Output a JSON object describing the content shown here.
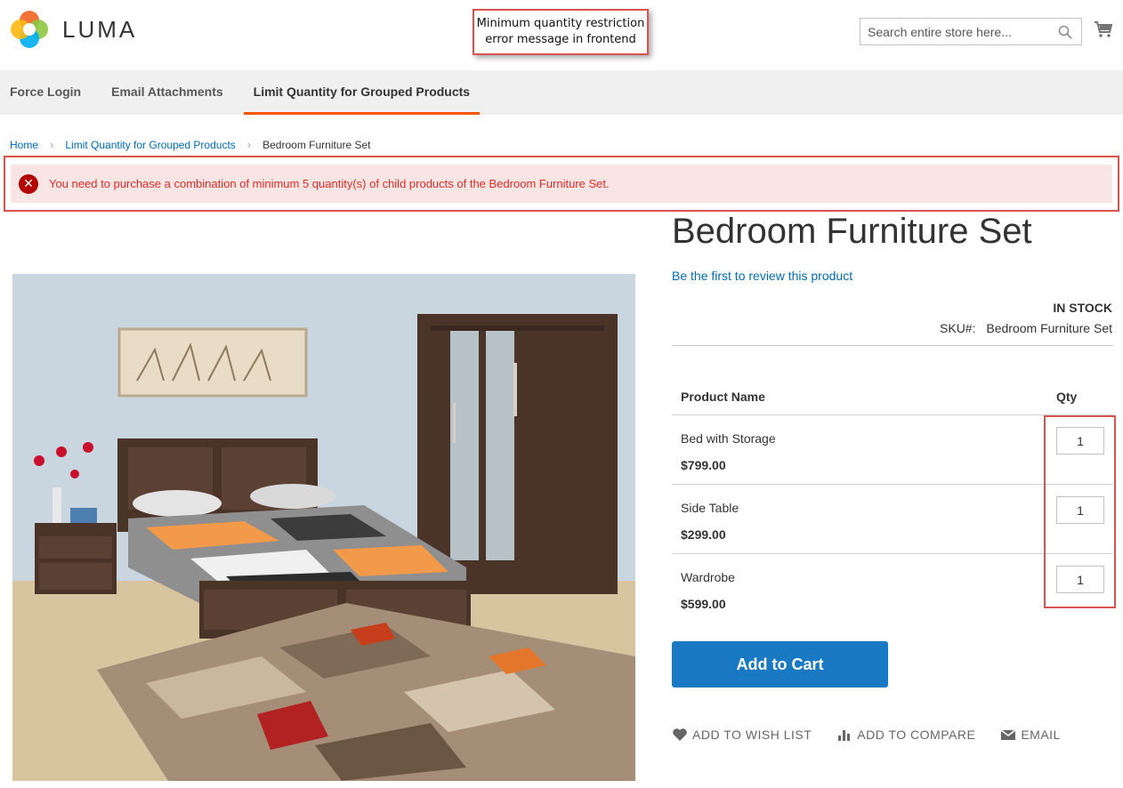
{
  "header": {
    "logo_text": "LUMA",
    "search_placeholder": "Search entire store here...",
    "callout_line1": "Minimum quantity restriction",
    "callout_line2": "error message in frontend"
  },
  "nav": {
    "items": [
      "Force Login",
      "Email Attachments",
      "Limit Quantity for Grouped Products"
    ],
    "active_index": 2
  },
  "breadcrumb": {
    "home": "Home",
    "category": "Limit Quantity for Grouped Products",
    "current": "Bedroom Furniture Set"
  },
  "message": {
    "error": "You need to purchase a combination of minimum 5 quantity(s) of child products of the Bedroom Furniture Set."
  },
  "product": {
    "title": "Bedroom Furniture Set",
    "review_link": "Be the first to review this product",
    "stock": "IN STOCK",
    "sku_label": "SKU#:",
    "sku_value": "Bedroom Furniture Set",
    "table_headers": {
      "name": "Product Name",
      "qty": "Qty"
    },
    "items": [
      {
        "name": "Bed with Storage",
        "price": "$799.00",
        "qty": "1"
      },
      {
        "name": "Side Table",
        "price": "$299.00",
        "qty": "1"
      },
      {
        "name": "Wardrobe",
        "price": "$599.00",
        "qty": "1"
      }
    ],
    "add_to_cart": "Add to Cart",
    "actions": {
      "wishlist": "ADD TO WISH LIST",
      "compare": "ADD TO COMPARE",
      "email": "EMAIL"
    }
  },
  "colors": {
    "accent_orange": "#ff5501",
    "link_blue": "#006bb4",
    "button_blue": "#1979c3",
    "error_bg": "#fae5e5",
    "error_text": "#e02b27",
    "highlight_red": "#d9534f"
  }
}
